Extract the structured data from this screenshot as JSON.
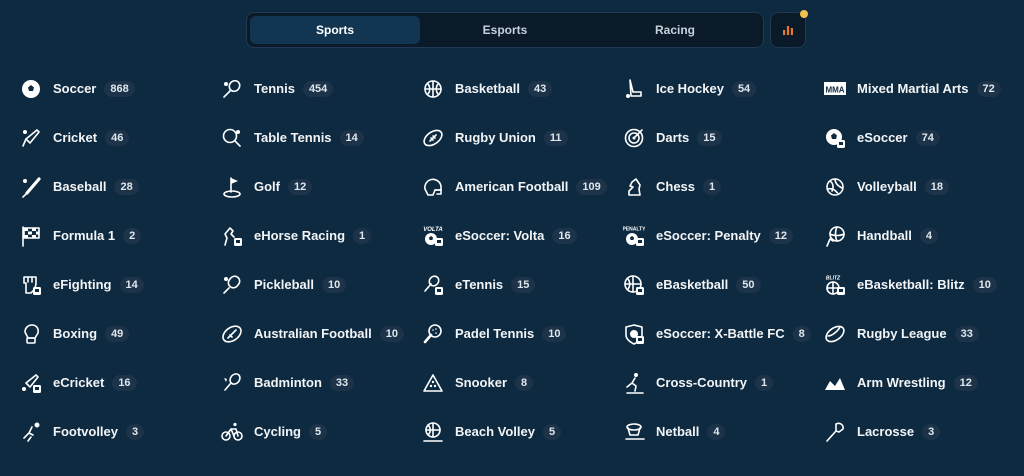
{
  "tabs": [
    {
      "label": "Sports",
      "active": true
    },
    {
      "label": "Esports",
      "active": false
    },
    {
      "label": "Racing",
      "active": false
    }
  ],
  "stats_button": {
    "icon": "bar-chart-icon",
    "accent": "#e8762c",
    "badge_color": "#f2c14e"
  },
  "sports": [
    {
      "name": "Soccer",
      "count": "868",
      "icon": "soccer-ball-icon"
    },
    {
      "name": "Tennis",
      "count": "454",
      "icon": "tennis-racket-icon"
    },
    {
      "name": "Basketball",
      "count": "43",
      "icon": "basketball-icon"
    },
    {
      "name": "Ice Hockey",
      "count": "54",
      "icon": "ice-hockey-stick-icon"
    },
    {
      "name": "Mixed Martial Arts",
      "count": "72",
      "icon": "mma-icon",
      "icon_text": "MMA"
    },
    {
      "name": "Cricket",
      "count": "46",
      "icon": "cricket-bat-icon"
    },
    {
      "name": "Table Tennis",
      "count": "14",
      "icon": "table-tennis-paddle-icon"
    },
    {
      "name": "Rugby Union",
      "count": "11",
      "icon": "rugby-ball-icon"
    },
    {
      "name": "Darts",
      "count": "15",
      "icon": "dartboard-icon"
    },
    {
      "name": "eSoccer",
      "count": "74",
      "icon": "esoccer-icon"
    },
    {
      "name": "Baseball",
      "count": "28",
      "icon": "baseball-bat-icon"
    },
    {
      "name": "Golf",
      "count": "12",
      "icon": "golf-flag-icon"
    },
    {
      "name": "American Football",
      "count": "109",
      "icon": "football-helmet-icon"
    },
    {
      "name": "Chess",
      "count": "1",
      "icon": "chess-knight-icon"
    },
    {
      "name": "Volleyball",
      "count": "18",
      "icon": "volleyball-icon"
    },
    {
      "name": "Formula 1",
      "count": "2",
      "icon": "checkered-flag-icon"
    },
    {
      "name": "eHorse Racing",
      "count": "1",
      "icon": "ehorse-racing-icon"
    },
    {
      "name": "eSoccer: Volta",
      "count": "16",
      "icon": "esoccer-volta-icon",
      "icon_text": "VOLTA"
    },
    {
      "name": "eSoccer: Penalty",
      "count": "12",
      "icon": "esoccer-penalty-icon",
      "icon_text": "PENALTY"
    },
    {
      "name": "Handball",
      "count": "4",
      "icon": "handball-icon"
    },
    {
      "name": "eFighting",
      "count": "14",
      "icon": "efighting-glove-icon"
    },
    {
      "name": "Pickleball",
      "count": "10",
      "icon": "pickleball-paddle-icon"
    },
    {
      "name": "eTennis",
      "count": "15",
      "icon": "etennis-icon"
    },
    {
      "name": "eBasketball",
      "count": "50",
      "icon": "ebasketball-icon"
    },
    {
      "name": "eBasketball: Blitz",
      "count": "10",
      "icon": "ebasketball-blitz-icon",
      "icon_text": "BLITZ"
    },
    {
      "name": "Boxing",
      "count": "49",
      "icon": "boxing-glove-icon"
    },
    {
      "name": "Australian Football",
      "count": "10",
      "icon": "australian-football-icon"
    },
    {
      "name": "Padel Tennis",
      "count": "10",
      "icon": "padel-racket-icon"
    },
    {
      "name": "eSoccer: X-Battle FC",
      "count": "8",
      "icon": "esoccer-xbattle-icon"
    },
    {
      "name": "Rugby League",
      "count": "33",
      "icon": "rugby-league-ball-icon"
    },
    {
      "name": "eCricket",
      "count": "16",
      "icon": "ecricket-icon"
    },
    {
      "name": "Badminton",
      "count": "33",
      "icon": "badminton-racket-icon"
    },
    {
      "name": "Snooker",
      "count": "8",
      "icon": "snooker-triangle-icon"
    },
    {
      "name": "Cross-Country",
      "count": "1",
      "icon": "cross-country-skier-icon"
    },
    {
      "name": "Arm Wrestling",
      "count": "12",
      "icon": "arm-wrestling-icon"
    },
    {
      "name": "Footvolley",
      "count": "3",
      "icon": "footvolley-icon"
    },
    {
      "name": "Cycling",
      "count": "5",
      "icon": "bicycle-icon"
    },
    {
      "name": "Beach Volley",
      "count": "5",
      "icon": "beach-volley-icon"
    },
    {
      "name": "Netball",
      "count": "4",
      "icon": "netball-icon"
    },
    {
      "name": "Lacrosse",
      "count": "3",
      "icon": "lacrosse-stick-icon"
    }
  ]
}
